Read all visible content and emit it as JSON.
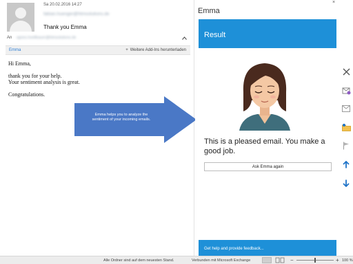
{
  "mail": {
    "date": "Sa 20.02.2016 14:27",
    "from": "fabian.huenger@htmsolutions.de",
    "subject": "Thank you Emma",
    "to_label": "An",
    "to_value": "agnes.hoellbauer@htmsolutions.de",
    "addin_tab": "Emma",
    "addin_more": "Weitere Add-Ins herunterladen",
    "body": {
      "greeting": "Hi Emma,",
      "line1": "thank you for your help.",
      "line2": "Your sentiment analysis is great.",
      "closing": "Congratulations."
    }
  },
  "callout": {
    "line1": "Emma helps you to analyze the",
    "line2": "sentiment of your incoming emails."
  },
  "pane": {
    "title": "Emma",
    "close": "×",
    "result_header": "Result",
    "verdict": "This is a pleased email. You make a good job.",
    "ask_button": "Ask Emma again",
    "help_link": "Get help and provide feedback..."
  },
  "rail": {
    "icons": [
      "close-x-icon",
      "reply-all-icon",
      "envelope-icon",
      "folder-move-icon",
      "flag-icon",
      "up-arrow-icon",
      "down-arrow-icon"
    ],
    "accent": "#1e73c8"
  },
  "status": {
    "folders": "Alle Ordner sind auf dem neuesten Stand.",
    "connection": "Verbunden mit Microsoft Exchange",
    "zoom": "100 %",
    "zoom_level": 0.5
  },
  "colors": {
    "accent_blue": "#1e90d8",
    "callout_blue": "#4a78c6",
    "link_blue": "#2b7cd3"
  }
}
